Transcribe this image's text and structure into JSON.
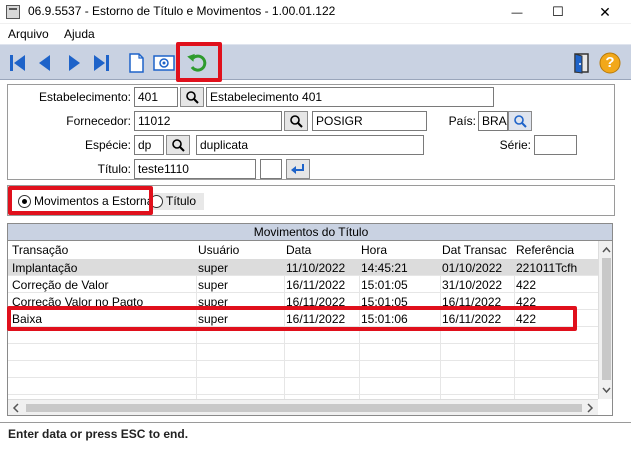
{
  "window": {
    "title": "06.9.5537 - Estorno de Título e Movimentos - 1.00.01.122",
    "minimize": "—",
    "maximize": "☐",
    "close": "✕"
  },
  "menu": {
    "items": [
      {
        "label": "Arquivo"
      },
      {
        "label": "Ajuda"
      }
    ]
  },
  "toolbar": {
    "buttons": [
      "first-icon",
      "previous-icon",
      "next-icon",
      "last-icon",
      "new-document-icon",
      "zoom-icon",
      "undo-icon"
    ],
    "right_buttons": [
      "exit-door-icon",
      "help-icon"
    ],
    "help_glyph": "?"
  },
  "form": {
    "estabelecimento": {
      "label": "Estabelecimento:",
      "code": "401",
      "desc": "Estabelecimento 401"
    },
    "fornecedor": {
      "label": "Fornecedor:",
      "code": "11012",
      "desc": "POSIGR"
    },
    "pais": {
      "label": "País:",
      "value": "BRA"
    },
    "especie": {
      "label": "Espécie:",
      "code": "dp",
      "desc": "duplicata"
    },
    "serie": {
      "label": "Série:",
      "value": ""
    },
    "titulo": {
      "label": "Título:",
      "value": "teste1110",
      "parcela": ""
    }
  },
  "options": {
    "movimentos": "Movimentos a Estornar",
    "titulo": "Título",
    "selected": "movimentos"
  },
  "grid": {
    "title": "Movimentos do Título",
    "columns": [
      "Transação",
      "Usuário",
      "Data",
      "Hora",
      "Dat Transac",
      "Referência"
    ],
    "rows": [
      [
        "Implantação",
        "super",
        "11/10/2022",
        "14:45:21",
        "01/10/2022",
        "221011Tcfh"
      ],
      [
        "Correção de Valor",
        "super",
        "16/11/2022",
        "15:01:05",
        "31/10/2022",
        "422"
      ],
      [
        "Correção Valor no Pagto",
        "super",
        "16/11/2022",
        "15:01:05",
        "16/11/2022",
        "422"
      ],
      [
        "Baixa",
        "super",
        "16/11/2022",
        "15:01:06",
        "16/11/2022",
        "422"
      ]
    ],
    "empty_rows": 4
  },
  "status": {
    "text": "Enter data or press ESC to end."
  },
  "colors": {
    "highlight": "#e0101c",
    "toolbar_bg": "#c9d2e2",
    "nav_arrow": "#1e63c9"
  }
}
